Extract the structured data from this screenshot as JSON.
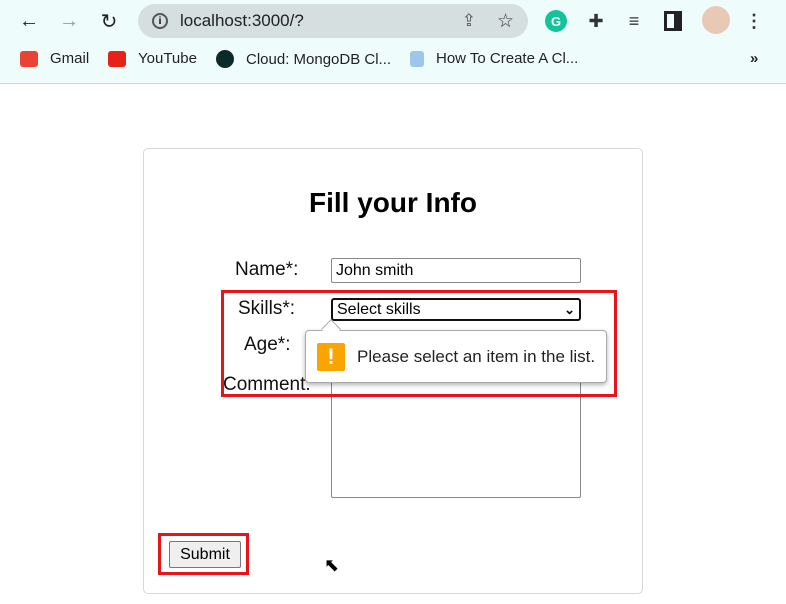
{
  "browser": {
    "url": "localhost:3000/?",
    "bookmarks": [
      {
        "label": "Gmail",
        "icon": "gmail-icon",
        "color": "#ea4335"
      },
      {
        "label": "YouTube",
        "icon": "youtube-icon",
        "color": "#e62117"
      },
      {
        "label": "Cloud: MongoDB Cl...",
        "icon": "mongodb-icon",
        "color": "#0b2a2a"
      },
      {
        "label": "How To Create A Cl...",
        "icon": "page-icon",
        "color": "#9cc6ea"
      }
    ],
    "more": "»"
  },
  "form": {
    "title": "Fill your Info",
    "name_label": "Name*:",
    "name_value": "John smith",
    "skills_label": "Skills*:",
    "skills_value": "Select skills",
    "age_label": "Age*:",
    "comment_label": "Comment:",
    "submit_label": "Submit"
  },
  "tooltip": {
    "message": "Please select an item in the list.",
    "icon": "!"
  }
}
